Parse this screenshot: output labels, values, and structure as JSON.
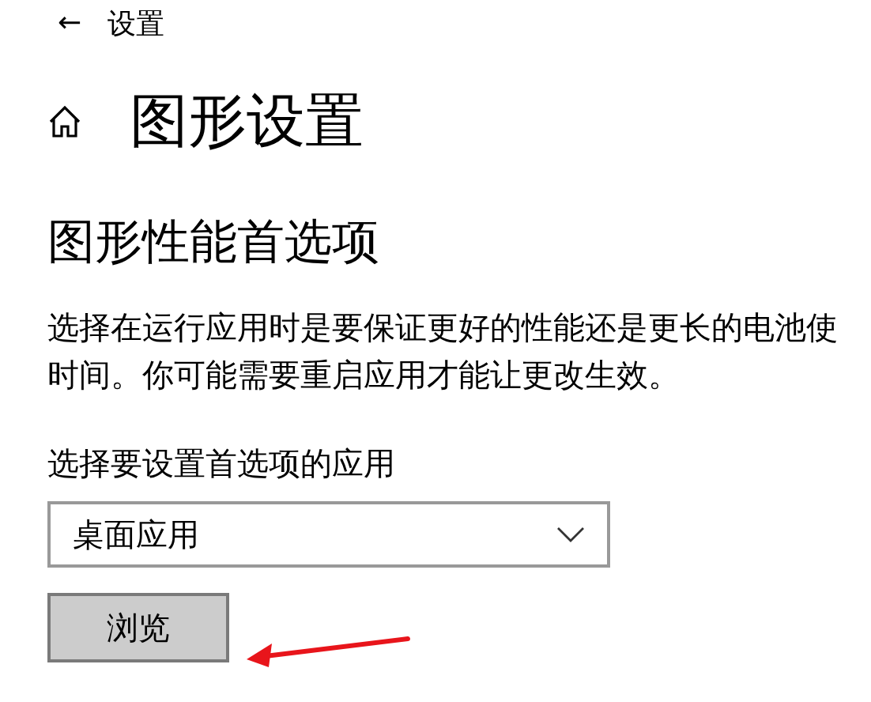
{
  "header": {
    "back": "←",
    "title": "设置"
  },
  "page_title": "图形设置",
  "section_heading": "图形性能首选项",
  "description_lines": [
    "选择在运行应用时是要保证更好的性能还是更长的电池使",
    "时间。你可能需要重启应用才能让更改生效。"
  ],
  "app_picker": {
    "label": "选择要设置首选项的应用",
    "value": "桌面应用"
  },
  "browse_button": "浏览"
}
